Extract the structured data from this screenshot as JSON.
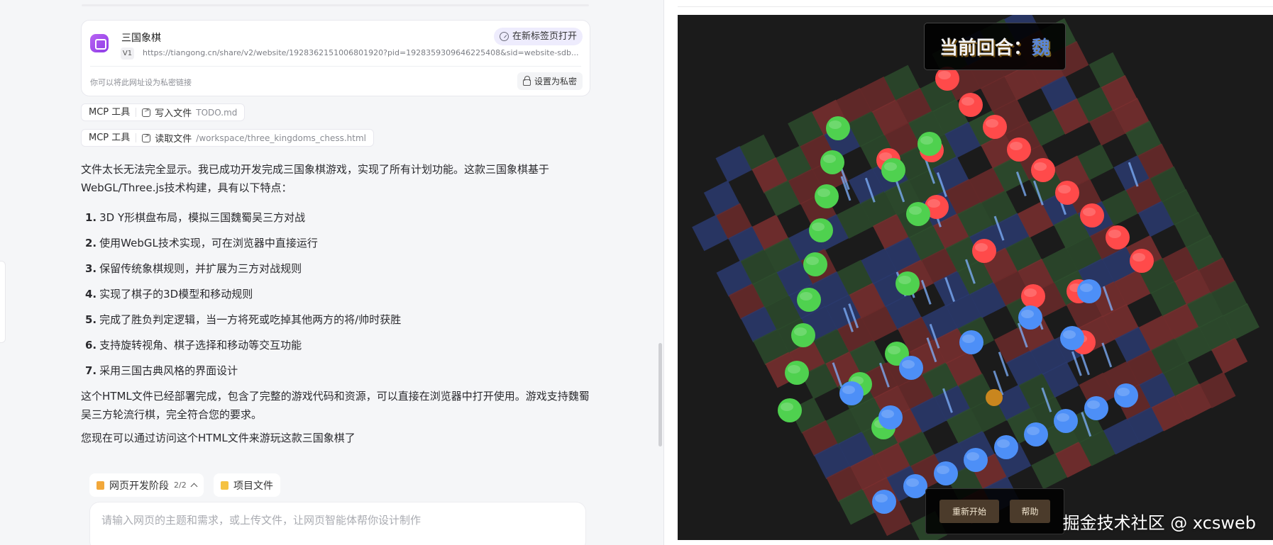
{
  "card": {
    "title": "三国象棋",
    "version": "V1",
    "url": "https://tiangong.cn/share/v2/website/1928362151006801920?pid=1928359309646225408&sid=website-sdb...",
    "open_new_tab": "在新标签页打开",
    "private_hint": "你可以将此网址设为私密链接",
    "set_private": "设置为私密"
  },
  "tools": [
    {
      "label": "MCP 工具",
      "action": "写入文件",
      "file": "TODO.md"
    },
    {
      "label": "MCP 工具",
      "action": "读取文件",
      "file": "/workspace/three_kingdoms_chess.html"
    }
  ],
  "message": {
    "intro": "文件太长无法完全显示。我已成功开发完成三国象棋游戏，实现了所有计划功能。这款三国象棋基于WebGL/Three.js技术构建，具有以下特点：",
    "features": [
      {
        "num": "1.",
        "text": "3D Y形棋盘布局，模拟三国魏蜀吴三方对战"
      },
      {
        "num": "2.",
        "text": "使用WebGL技术实现，可在浏览器中直接运行"
      },
      {
        "num": "3.",
        "text": "保留传统象棋规则，并扩展为三方对战规则"
      },
      {
        "num": "4.",
        "text": "实现了棋子的3D模型和移动规则"
      },
      {
        "num": "5.",
        "text": "完成了胜负判定逻辑，当一方将死或吃掉其他两方的将/帅时获胜"
      },
      {
        "num": "6.",
        "text": "支持旋转视角、棋子选择和移动等交互功能"
      },
      {
        "num": "7.",
        "text": "采用三国古典风格的界面设计"
      }
    ],
    "deploy": "这个HTML文件已经部署完成，包含了完整的游戏代码和资源，可以直接在浏览器中打开使用。游戏支持魏蜀吴三方轮流行棋，完全符合您的要求。",
    "closing": "您现在可以通过访问这个HTML文件来游玩这款三国象棋了"
  },
  "bottom": {
    "stage_label": "网页开发阶段",
    "stage_count": "2/2",
    "files_label": "项目文件",
    "input_placeholder": "请输入网页的主题和需求，或上传文件，让网页智能体帮你设计制作"
  },
  "game": {
    "turn_label": "当前回合：",
    "turn_player": "魏",
    "restart": "重新开始",
    "help": "帮助",
    "colors": {
      "red": "#ff4a4a",
      "green": "#4fd14f",
      "blue": "#4d8ff7",
      "gold": "#c9861e"
    }
  },
  "watermark": "掘金技术社区 @ xcsweb"
}
